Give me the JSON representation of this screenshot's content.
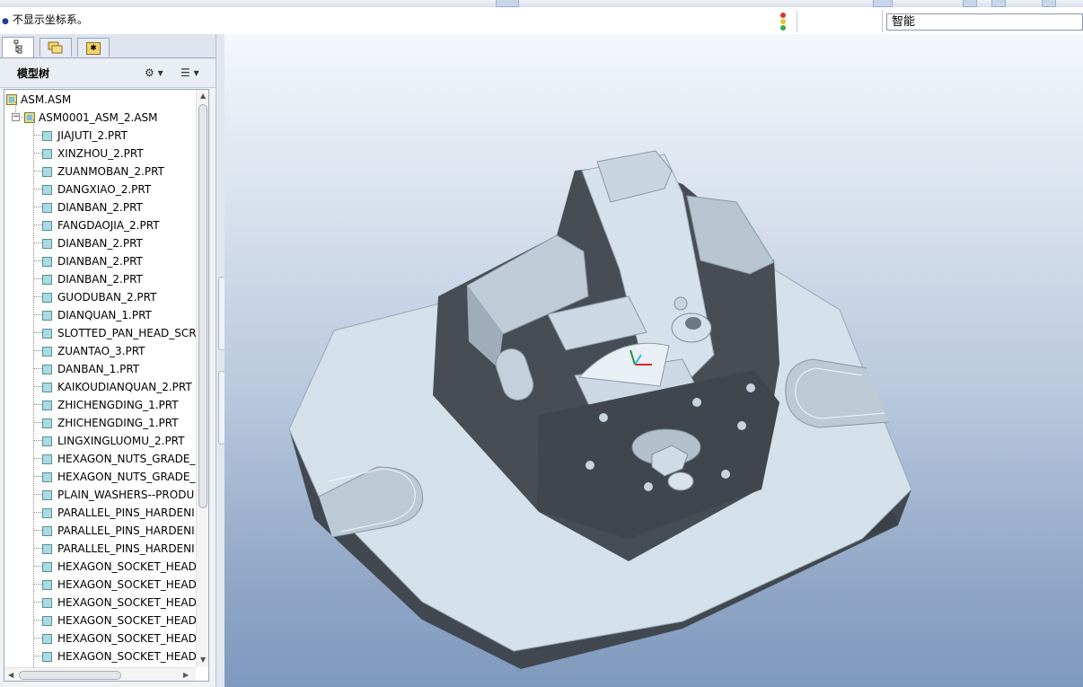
{
  "message": {
    "text": "不显示坐标系。"
  },
  "filter": {
    "value": "智能"
  },
  "panel": {
    "tabs": [
      {
        "name": "model-tree-tab",
        "glyph": ""
      },
      {
        "name": "folder-browser-tab",
        "glyph": ""
      },
      {
        "name": "favorites-tab",
        "glyph": "✱"
      }
    ],
    "title": "模型树",
    "settings_glyph": "⚙ ▾",
    "show_glyph": "☰ ▾"
  },
  "tree": {
    "root": "ASM.ASM",
    "subassembly": "ASM0001_ASM_2.ASM",
    "parts": [
      "JIAJUTI_2.PRT",
      "XINZHOU_2.PRT",
      "ZUANMOBAN_2.PRT",
      "DANGXIAO_2.PRT",
      "DIANBAN_2.PRT",
      "FANGDAOJIA_2.PRT",
      "DIANBAN_2.PRT",
      "DIANBAN_2.PRT",
      "DIANBAN_2.PRT",
      "GUODUBAN_2.PRT",
      "DIANQUAN_1.PRT",
      "SLOTTED_PAN_HEAD_SCR",
      "ZUANTAO_3.PRT",
      "DANBAN_1.PRT",
      "KAIKOUDIANQUAN_2.PRT",
      "ZHICHENGDING_1.PRT",
      "ZHICHENGDING_1.PRT",
      "LINGXINGLUOMU_2.PRT",
      "HEXAGON_NUTS_GRADE_",
      "HEXAGON_NUTS_GRADE_",
      "PLAIN_WASHERS--PRODU",
      "PARALLEL_PINS_HARDENI",
      "PARALLEL_PINS_HARDENI",
      "PARALLEL_PINS_HARDENI",
      "HEXAGON_SOCKET_HEAD",
      "HEXAGON_SOCKET_HEAD",
      "HEXAGON_SOCKET_HEAD",
      "HEXAGON_SOCKET_HEAD",
      "HEXAGON_SOCKET_HEAD",
      "HEXAGON_SOCKET_HEAD"
    ]
  },
  "colors": {
    "part_face_light": "#dbe7f0",
    "part_face_mid": "#b9c6d2",
    "part_face_dark": "#434a52",
    "background_top": "#f4f7fb",
    "background_bottom": "#7f99be"
  }
}
